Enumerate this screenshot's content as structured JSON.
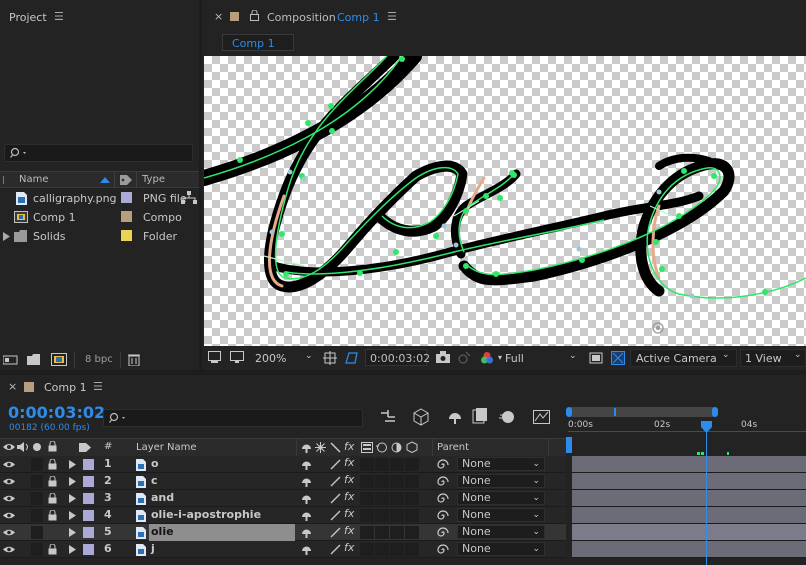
{
  "project": {
    "title": "Project",
    "columns": {
      "name": "Name",
      "type": "Type"
    },
    "items": [
      {
        "name": "calligraphy.png",
        "type": "PNG file",
        "label_color": "#aaa9d8",
        "icon": "image-file-icon"
      },
      {
        "name": "Comp 1",
        "type": "Compo",
        "label_color": "#b79f7e",
        "icon": "composition-icon"
      },
      {
        "name": "Solids",
        "type": "Folder",
        "label_color": "#e8d552",
        "icon": "folder-icon"
      }
    ],
    "bpc": "8 bpc"
  },
  "composition": {
    "title_prefix": "Composition",
    "title_comp": "Comp 1",
    "tab": "Comp 1",
    "zoom": "200%",
    "timecode": "0:00:03:02",
    "resolution": "Full",
    "camera": "Active Camera",
    "views": "1 View"
  },
  "timeline": {
    "tab": "Comp 1",
    "timecode": "0:00:03:02",
    "frames": "00182 (60.00 fps)",
    "header": {
      "hash": "#",
      "layer_name": "Layer Name",
      "parent": "Parent"
    },
    "ruler": [
      "0:00s",
      "02s",
      "04s"
    ],
    "layers": [
      {
        "num": "1",
        "name": "o",
        "parent": "None",
        "selected": false
      },
      {
        "num": "2",
        "name": "c",
        "parent": "None",
        "selected": false
      },
      {
        "num": "3",
        "name": "and",
        "parent": "None",
        "selected": false
      },
      {
        "num": "4",
        "name": "olie-i-apostrophie",
        "parent": "None",
        "selected": false
      },
      {
        "num": "5",
        "name": "olie",
        "parent": "None",
        "selected": true
      },
      {
        "num": "6",
        "name": "j",
        "parent": "None",
        "selected": false
      }
    ]
  },
  "colors": {
    "accent_blue": "#2d8ceb",
    "stroke_green": "#2ee86a",
    "layer_label": "#aaa9d8",
    "track": "#6c6b78"
  }
}
